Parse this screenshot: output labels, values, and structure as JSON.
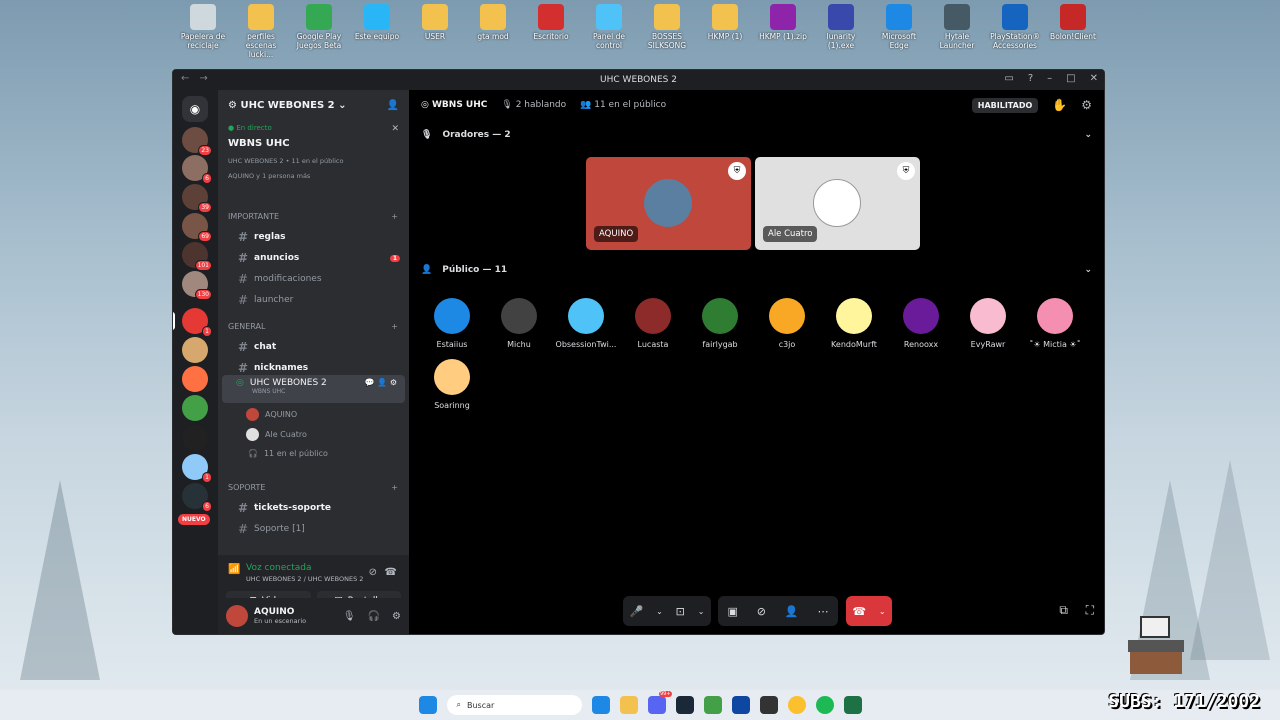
{
  "desktop": {
    "icons": [
      {
        "label": "Papelera de reciclaje",
        "color": "#cfd8dc"
      },
      {
        "label": "perfiles escenas lucki...",
        "color": "#f2c14e"
      },
      {
        "label": "Google Play Juegos Beta",
        "color": "#34a853"
      },
      {
        "label": "Este equipo",
        "color": "#29b6f6"
      },
      {
        "label": "USER",
        "color": "#f2c14e"
      },
      {
        "label": "gta mod",
        "color": "#f2c14e"
      },
      {
        "label": "Escritorio",
        "color": "#d32f2f"
      },
      {
        "label": "Panel de control",
        "color": "#4fc3f7"
      },
      {
        "label": "BOSSES SILKSONG",
        "color": "#f2c14e"
      },
      {
        "label": "HKMP (1)",
        "color": "#f2c14e"
      },
      {
        "label": "HKMP (1).zip",
        "color": "#8e24aa"
      },
      {
        "label": "lunarity (1).exe",
        "color": "#3949ab"
      },
      {
        "label": "Microsoft Edge",
        "color": "#1e88e5"
      },
      {
        "label": "Hytale Launcher",
        "color": "#455a64"
      },
      {
        "label": "PlayStation® Accessories",
        "color": "#1565c0"
      },
      {
        "label": "Bolon!Client",
        "color": "#c62828"
      }
    ]
  },
  "window": {
    "title": "UHC WEBONES 2"
  },
  "guilds": [
    {
      "badge": "23",
      "color": "#6d4c41"
    },
    {
      "badge": "6",
      "color": "#8d6e63"
    },
    {
      "badge": "39",
      "color": "#5d4037"
    },
    {
      "badge": "69",
      "color": "#795548"
    },
    {
      "badge": "101",
      "color": "#4e342e"
    },
    {
      "badge": "130",
      "color": "#a1887f"
    },
    {
      "badge": "1",
      "color": "#e53935"
    },
    {
      "badge": "",
      "color": "#d7a86e"
    },
    {
      "badge": "",
      "color": "#ff7043"
    },
    {
      "badge": "",
      "color": "#43a047"
    },
    {
      "badge": "",
      "color": "#212121"
    },
    {
      "badge": "1",
      "color": "#90caf9"
    },
    {
      "badge": "6",
      "color": "#263238"
    }
  ],
  "guild_new": "NUEVO",
  "server": {
    "name": "UHC WEBONES 2",
    "live": {
      "status": "En directo",
      "title": "WBNS UHC",
      "meta": "UHC WEBONES 2 • 11 en el público",
      "people": "AQUINO y 1 persona más"
    },
    "categories": [
      {
        "label": "IMPORTANTE",
        "channels": [
          {
            "name": "reglas",
            "bright": true
          },
          {
            "name": "anuncios",
            "bright": true,
            "badge": "1"
          },
          {
            "name": "modificaciones",
            "bright": false
          },
          {
            "name": "launcher",
            "bright": false
          }
        ]
      },
      {
        "label": "GENERAL",
        "channels": [
          {
            "name": "chat",
            "bright": true
          },
          {
            "name": "nicknames",
            "bright": true
          }
        ]
      },
      {
        "label": "SOPORTE",
        "channels": [
          {
            "name": "tickets-soporte",
            "bright": true
          },
          {
            "name": "Soporte [1]",
            "bright": false
          }
        ]
      }
    ],
    "stage": {
      "name": "UHC WEBONES 2",
      "sub": "WBNS UHC",
      "members": [
        "AQUINO",
        "Ale Cuatro"
      ],
      "audience": "11 en el público"
    }
  },
  "voice": {
    "status": "Voz conectada",
    "location": "UHC WEBONES 2 / UHC WEBONES 2",
    "video": "Video",
    "screen": "Pantalla"
  },
  "user": {
    "name": "AQUINO",
    "status": "En un escenario"
  },
  "topbar": {
    "stage": "WBNS UHC",
    "speaking": "2 hablando",
    "audience": "11 en el público",
    "enabled": "HABILITADO"
  },
  "speakers_label": "Oradores — 2",
  "speakers": [
    {
      "name": "AQUINO",
      "bg": "#c0473c"
    },
    {
      "name": "Ale Cuatro",
      "bg": "#e0e0e0"
    }
  ],
  "audience_label": "Público — 11",
  "audience": [
    {
      "name": "Estaiius",
      "color": "#1e88e5"
    },
    {
      "name": "Michu",
      "color": "#424242"
    },
    {
      "name": "ObsessionTwi...",
      "color": "#4fc3f7"
    },
    {
      "name": "Lucasta",
      "color": "#8d2a2a"
    },
    {
      "name": "fairlygab",
      "color": "#2e7d32"
    },
    {
      "name": "c3jo",
      "color": "#f9a825"
    },
    {
      "name": "KendoMurft",
      "color": "#fff59d"
    },
    {
      "name": "Renooxx",
      "color": "#6a1b9a"
    },
    {
      "name": "EvyRawr",
      "color": "#f8bbd0"
    },
    {
      "name": "˚☀ Mictia ☀˚",
      "color": "#f48fb1"
    },
    {
      "name": "Soarinng",
      "color": "#ffcc80"
    }
  ],
  "taskbar": {
    "search": "Buscar",
    "badge": "99+"
  },
  "overlay": {
    "subs": "SUBS: 171/2002"
  }
}
